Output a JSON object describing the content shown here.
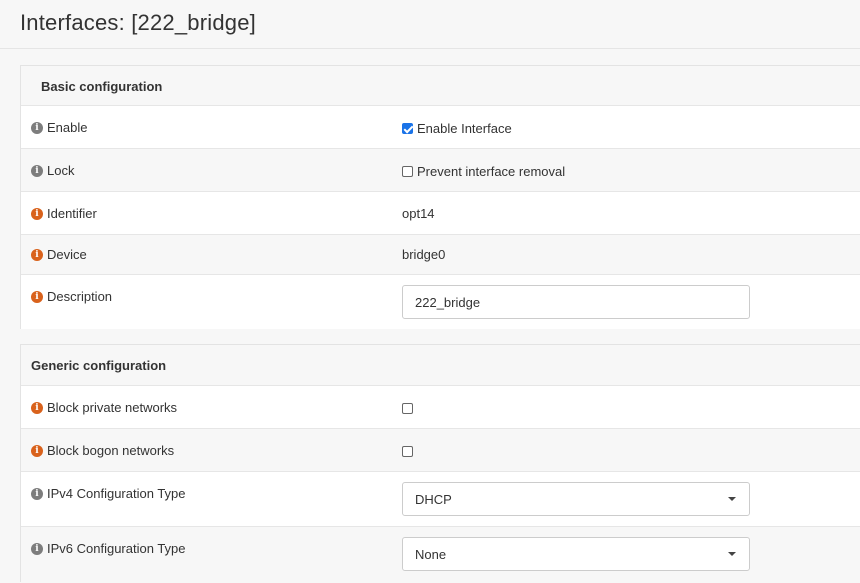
{
  "header": {
    "title": "Interfaces: [222_bridge]"
  },
  "basic": {
    "heading": "Basic configuration",
    "enable": {
      "label": "Enable",
      "checkbox_label": "Enable Interface",
      "checked": true
    },
    "lock": {
      "label": "Lock",
      "checkbox_label": "Prevent interface removal",
      "checked": false
    },
    "identifier": {
      "label": "Identifier",
      "value": "opt14"
    },
    "device": {
      "label": "Device",
      "value": "bridge0"
    },
    "description": {
      "label": "Description",
      "value": "222_bridge"
    }
  },
  "generic": {
    "heading": "Generic configuration",
    "block_private": {
      "label": "Block private networks",
      "checked": false
    },
    "block_bogon": {
      "label": "Block bogon networks",
      "checked": false
    },
    "ipv4_type": {
      "label": "IPv4 Configuration Type",
      "selected": "DHCP"
    },
    "ipv6_type": {
      "label": "IPv6 Configuration Type",
      "selected": "None"
    }
  },
  "colors": {
    "info_gray": "#7d7d7d",
    "info_orange": "#d9621c",
    "checkbox_checked": "#1a73e8"
  },
  "icons": {
    "info": "info-circle-icon",
    "select_caret": "caret-down-icon"
  }
}
